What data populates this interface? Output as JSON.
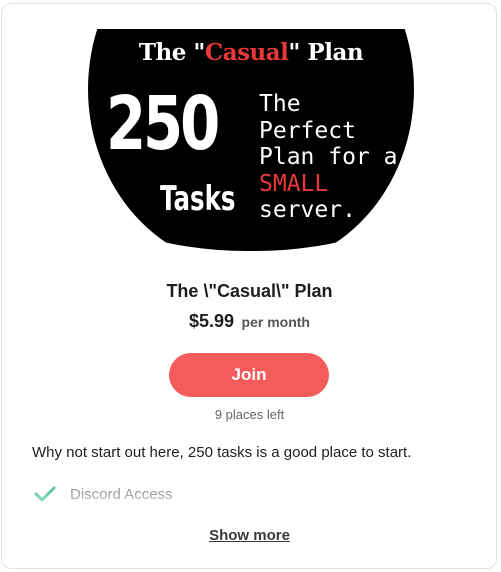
{
  "banner": {
    "title_prefix": "The \"",
    "title_highlight": "Casual",
    "title_suffix": "\" Plan",
    "number": "250",
    "tasks_word": "Tasks",
    "tagline_line1": "The",
    "tagline_line2": "Perfect",
    "tagline_line3": "Plan for a",
    "tagline_highlight": "SMALL",
    "tagline_line5": "server.",
    "colors": {
      "background": "#000000",
      "text": "#ffffff",
      "accent": "#e8383a"
    }
  },
  "plan": {
    "name": "The \\\"Casual\\\" Plan",
    "price": "$5.99",
    "period": "per month"
  },
  "join_button": {
    "label": "Join",
    "color": "#f45b5b"
  },
  "availability": "9 places left",
  "description": "Why not start out here, 250 tasks is a good place to start.",
  "benefits": [
    {
      "label": "Discord Access",
      "icon": "check-icon"
    }
  ],
  "show_more_label": "Show more"
}
